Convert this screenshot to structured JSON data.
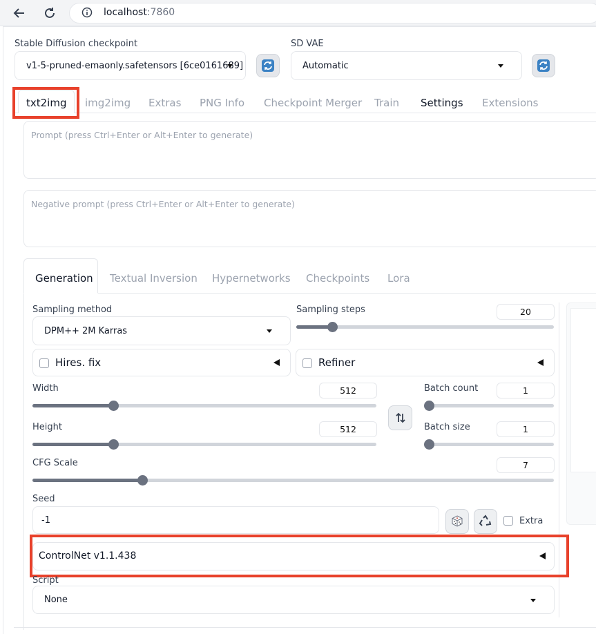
{
  "browser": {
    "url_host": "localhost",
    "url_port": ":7860"
  },
  "top": {
    "checkpoint_label": "Stable Diffusion checkpoint",
    "checkpoint_value": "v1-5-pruned-emaonly.safetensors [6ce0161689]",
    "vae_label": "SD VAE",
    "vae_value": "Automatic"
  },
  "main_tabs": [
    "txt2img",
    "img2img",
    "Extras",
    "PNG Info",
    "Checkpoint Merger",
    "Train",
    "Settings",
    "Extensions"
  ],
  "prompt": {
    "positive_placeholder": "Prompt (press Ctrl+Enter or Alt+Enter to generate)",
    "negative_placeholder": "Negative prompt (press Ctrl+Enter or Alt+Enter to generate)"
  },
  "sub_tabs": [
    "Generation",
    "Textual Inversion",
    "Hypernetworks",
    "Checkpoints",
    "Lora"
  ],
  "generation": {
    "sampling_method_label": "Sampling method",
    "sampling_method_value": "DPM++ 2M Karras",
    "sampling_steps_label": "Sampling steps",
    "sampling_steps_value": "20",
    "hires_label": "Hires. fix",
    "refiner_label": "Refiner",
    "width_label": "Width",
    "width_value": "512",
    "height_label": "Height",
    "height_value": "512",
    "batch_count_label": "Batch count",
    "batch_count_value": "1",
    "batch_size_label": "Batch size",
    "batch_size_value": "1",
    "cfg_label": "CFG Scale",
    "cfg_value": "7",
    "seed_label": "Seed",
    "seed_value": "-1",
    "extra_label": "Extra",
    "controlnet_label": "ControlNet v1.1.438",
    "script_label": "Script",
    "script_value": "None"
  },
  "sliders": {
    "sampling_steps": 0.14,
    "width": 0.235,
    "height": 0.235,
    "batch_count": 0.0,
    "batch_size": 0.0,
    "cfg": 0.21
  },
  "colors": {
    "highlight": "#e8412b"
  },
  "icons": {
    "back": "back-arrow-icon",
    "reload": "reload-icon",
    "info": "info-icon",
    "refresh": "refresh-icon",
    "swap": "swap-icon",
    "dice": "dice-icon",
    "recycle": "recycle-icon"
  }
}
